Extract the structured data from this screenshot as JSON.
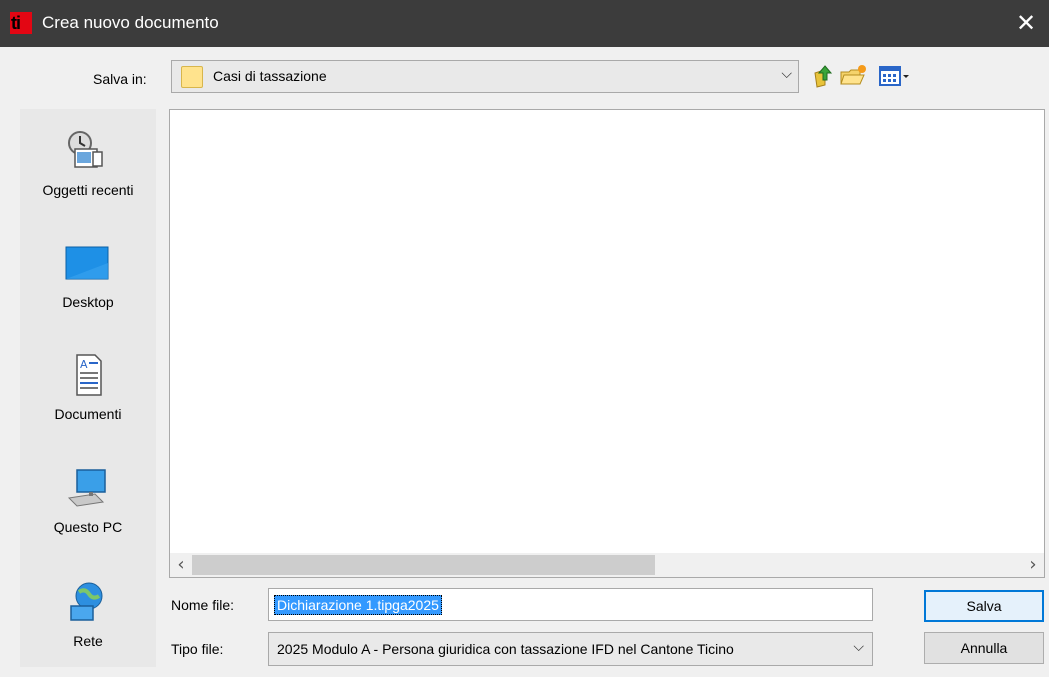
{
  "window": {
    "app_icon_text": "ti",
    "title": "Crea nuovo documento",
    "close_glyph": "✕"
  },
  "save_in": {
    "label": "Salva in:",
    "value": "Casi di tassazione",
    "arrow": "⌵"
  },
  "toolbar": {
    "up_icon": "up-folder-icon",
    "new_folder_icon": "new-folder-icon",
    "view_icon": "view-menu-icon"
  },
  "places": [
    {
      "label": "Oggetti recenti",
      "icon": "recent-items-icon"
    },
    {
      "label": "Desktop",
      "icon": "desktop-icon"
    },
    {
      "label": "Documenti",
      "icon": "documents-icon"
    },
    {
      "label": "Questo PC",
      "icon": "computer-icon"
    },
    {
      "label": "Rete",
      "icon": "network-icon"
    }
  ],
  "scroll": {
    "left": "‹",
    "right": "›"
  },
  "file_name": {
    "label": "Nome file:",
    "value": "Dichiarazione 1.tipga2025"
  },
  "file_type": {
    "label": "Tipo file:",
    "value": "2025 Modulo A - Persona giuridica con tassazione IFD nel Cantone Ticino",
    "arrow": "⌵"
  },
  "buttons": {
    "save": "Salva",
    "cancel": "Annulla"
  }
}
